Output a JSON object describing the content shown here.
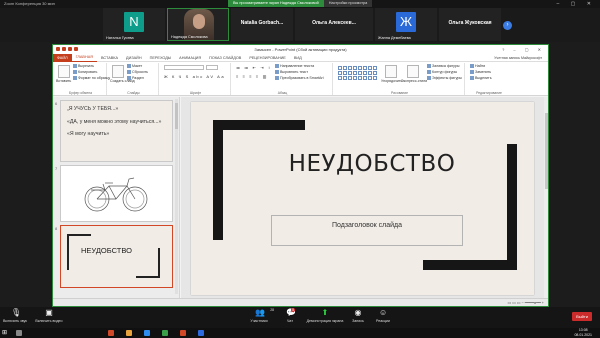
{
  "zoom": {
    "window_title": "Zoom Конференция 30 мин",
    "share_banner": "Вы просматриваете экран Надежда Смоляковой",
    "share_options": "Настройки просмотра"
  },
  "participants": [
    {
      "name": "Наталья Гусева",
      "initial": "N",
      "color": "#0d9d8a"
    },
    {
      "name": "Надежда Смоляковa",
      "video": true
    },
    {
      "name": "Natalia Gorbach...",
      "display": "Natalia Gorbach..."
    },
    {
      "name": "Ольга Алексеев...",
      "display": "Ольга Алексеев..."
    },
    {
      "name": "Жанна Демебаева",
      "initial": "Ж",
      "color": "#2a6ad8"
    },
    {
      "name": "Ольга Жуковская",
      "display": "Ольга Жуковская"
    }
  ],
  "ppt": {
    "title": "Замысел - PowerPoint (Сбой активации продукта)",
    "tabs": [
      "ФАЙЛ",
      "ГЛАВНАЯ",
      "ВСТАВКА",
      "ДИЗАЙН",
      "ПЕРЕХОДЫ",
      "АНИМАЦИЯ",
      "ПОКАЗ СЛАЙДОВ",
      "РЕЦЕНЗИРОВАНИЕ",
      "ВИД"
    ],
    "user": "Учетная запись Майкрософт",
    "ribbon": {
      "paste": "Вставить",
      "cut": "Вырезать",
      "copy": "Копировать",
      "format_painter": "Формат по образцу",
      "clipboard": "Буфер обмена",
      "new_slide": "Создать слайд",
      "layout": "Макет",
      "reset": "Сбросить",
      "section": "Раздел",
      "slides": "Слайды",
      "font": "Шрифт",
      "paragraph": "Абзац",
      "text_direction": "Направление текста",
      "align_text": "Выровнять текст",
      "smartart": "Преобразовать в SmartArt",
      "drawing": "Рисование",
      "arrange": "Упорядочить",
      "quick_styles": "Экспресс-стили",
      "shape_fill": "Заливка фигуры",
      "shape_outline": "Контур фигуры",
      "shape_effects": "Эффекты фигуры",
      "find": "Найти",
      "replace": "Заменить",
      "select": "Выделить",
      "editing": "Редактирование"
    },
    "thumbs": [
      {
        "num": "6",
        "lines": [
          "„Я УЧУСЬ У ТЕБЯ...»",
          "«ДА, у меня можно этому научиться...»",
          "«Я могу научить»"
        ]
      },
      {
        "num": "7"
      },
      {
        "num": "8",
        "title": "НЕУДОБСТВО"
      }
    ],
    "slide": {
      "title": "НЕУДОБСТВО",
      "subtitle": "Подзаголовок слайда"
    }
  },
  "zoom_bar": {
    "mute": "Включить звук",
    "video": "Включить видео",
    "participants": "Участники",
    "participants_count": "28",
    "chat": "Чат",
    "chat_badge": "5",
    "share": "Демонстрация экрана",
    "record": "Запись",
    "reactions": "Реакции",
    "end": "Выйти"
  },
  "taskbar": {
    "time": "13:08",
    "date": "08.01.2021"
  }
}
